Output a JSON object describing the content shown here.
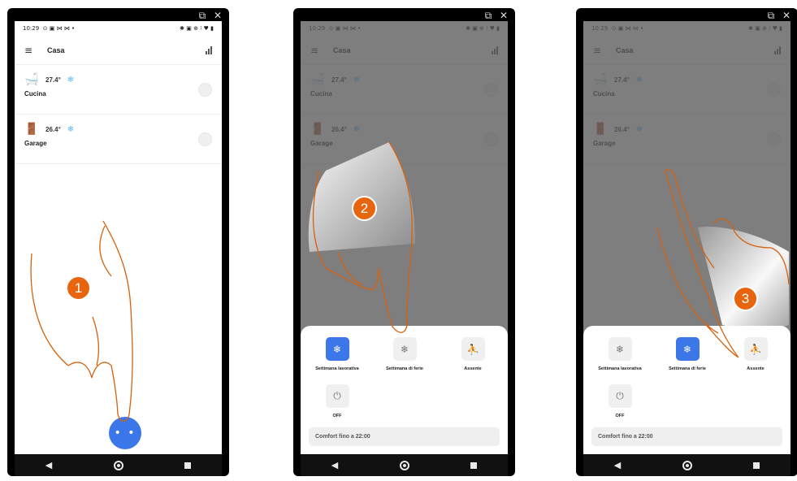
{
  "window_icons": "⧉ ✕",
  "status_bar": {
    "time": "10:29",
    "left_icons": "⊙ ▣ ⋈ ⋈ •",
    "right_icons": "✱ ▣ ⊕ ⁝ ♥ ▮"
  },
  "app": {
    "title": "Casa",
    "menu_icon": "≡",
    "chart_icon": "bar-chart-icon"
  },
  "zones": [
    {
      "name": "Cucina",
      "temp": "27.4°",
      "icon": "bathtub-icon",
      "mode_icon": "snowflake-icon"
    },
    {
      "name": "Garage",
      "temp": "26.4°",
      "icon": "door-icon",
      "mode_icon": "snowflake-icon"
    }
  ],
  "fab_label": "• •",
  "modes": [
    {
      "label": "Settimana lavorativa",
      "glyph": "❄"
    },
    {
      "label": "Settimana di ferie",
      "glyph": "❄"
    },
    {
      "label": "Assente",
      "glyph": "⛹"
    },
    {
      "label": "OFF",
      "glyph": "⏻"
    }
  ],
  "comfort_label": "Comfort fino a 22:00",
  "steps": {
    "one": "1",
    "two": "2",
    "three": "3"
  },
  "panel2_active_mode": "Settimana lavorativa",
  "panel3_active_mode": "Settimana di ferie",
  "colors": {
    "accent": "#3b77e8",
    "badge": "#e8650f",
    "snow": "#5bb8e8",
    "hand": "#d4620e"
  },
  "nav": {
    "back": "◀",
    "home": "home-icon",
    "recents": "square-icon"
  }
}
